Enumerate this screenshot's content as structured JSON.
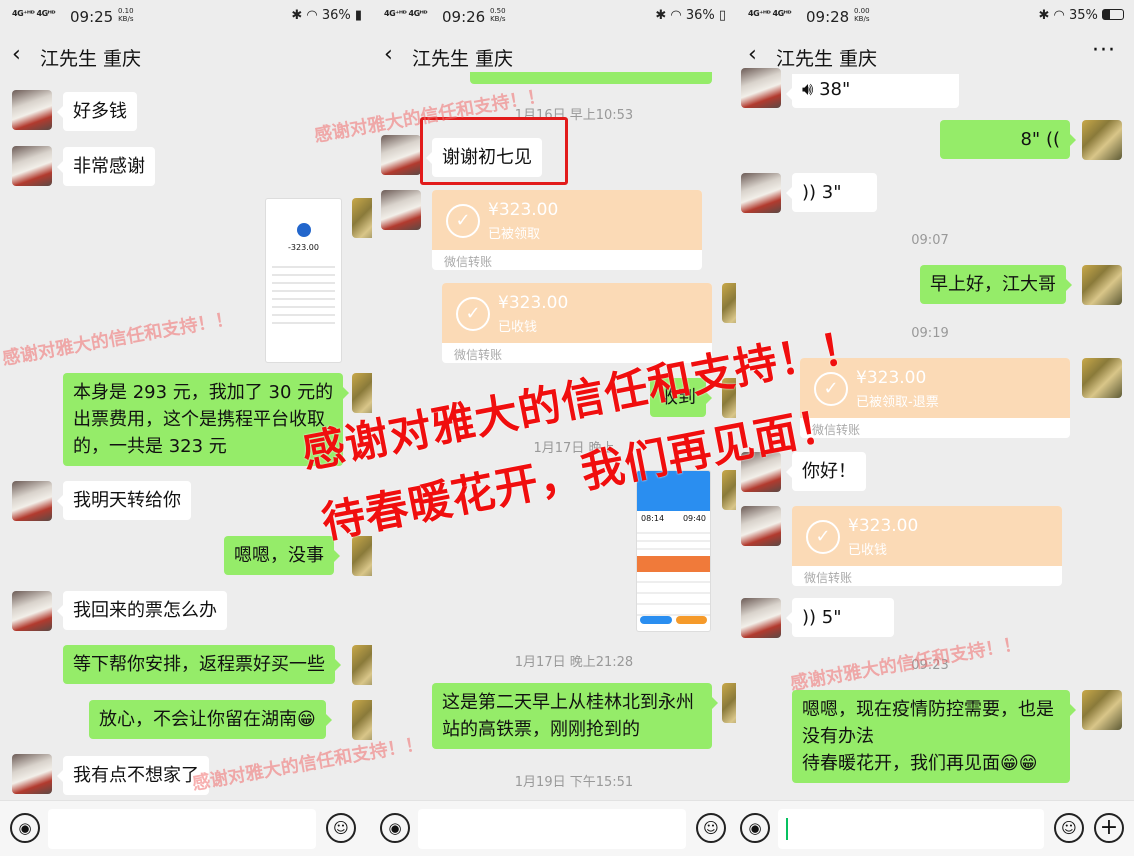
{
  "panels": [
    {
      "status": {
        "signal": "4G⁺ᴴᴰ 4Gᴴᴰ",
        "time": "09:25",
        "speed": "0.10",
        "speed_unit": "KB/s",
        "right": "✱ ◠ 36% ▮"
      },
      "header": {
        "back": "‹",
        "title": "江先生 重庆"
      },
      "messages": [
        "好多钱",
        "非常感谢",
        "本身是 293 元，我加了 30 元的",
        "出票费用，这个是携程平台收取",
        "的，一共是 323 元",
        "我明天转给你",
        "嗯嗯，没事",
        "我回来的票怎么办",
        "等下帮你安排，返程票好买一些",
        "放心，不会让你留在湖南😁",
        "我有点不想家了"
      ],
      "receipt": {
        "amount": "-323.00"
      }
    },
    {
      "status": {
        "signal": "4G⁺ᴴᴰ 4Gᴴᴰ",
        "time": "09:26",
        "speed": "0.50",
        "speed_unit": "KB/s",
        "right": "✱ ◠ 36% ▯"
      },
      "header": {
        "back": "‹",
        "title": "江先生 重庆"
      },
      "times": [
        "1月16日 早上10:53",
        "1月17日 晚上",
        "1月17日 晚上21:28",
        "1月19日 下午15:51"
      ],
      "messages": [
        "谢谢初七见",
        "收到",
        "这是第二天早上从桂林北到永州",
        "站的高铁票，刚刚抢到的"
      ],
      "transfers": [
        {
          "amount": "¥323.00",
          "status": "已被领取",
          "footer": "微信转账"
        },
        {
          "amount": "¥323.00",
          "status": "已收钱",
          "footer": "微信转账"
        }
      ],
      "ticket": {
        "dep": "08:14",
        "arr": "09:40"
      }
    },
    {
      "status": {
        "signal": "4G⁺ᴴᴰ 4Gᴴᴰ",
        "time": "09:28",
        "speed": "0.00",
        "speed_unit": "KB/s",
        "right": "✱ ◠ 35%"
      },
      "header": {
        "back": "‹",
        "title": "江先生 重庆",
        "more": "···"
      },
      "times": [
        "09:07",
        "09:19",
        "09:23"
      ],
      "voices": [
        "38\"",
        "8\"",
        "3\"",
        "5\""
      ],
      "messages": [
        "早上好，江大哥",
        "你好！",
        "嗯嗯，现在疫情防控需要，也是",
        "没有办法",
        "待春暖花开，我们再见面😁😁"
      ],
      "transfers": [
        {
          "amount": "¥323.00",
          "status": "已被领取-退票",
          "footer": "微信转账"
        },
        {
          "amount": "¥323.00",
          "status": "已收钱",
          "footer": "微信转账"
        }
      ]
    }
  ],
  "input": {
    "voice": "◉",
    "emoji": "☺",
    "plus": "+"
  },
  "watermark": {
    "small": "感谢对雅大的信任和支持！！",
    "line1": "感谢对雅大的信任和支持！！",
    "line2": "待春暖花开，我们再见面！"
  },
  "colors": {
    "green_bubble": "#95ec69",
    "transfer": "#fbdab6",
    "watermark": "#f00e0e",
    "highlight_box": "#e21b1b"
  }
}
